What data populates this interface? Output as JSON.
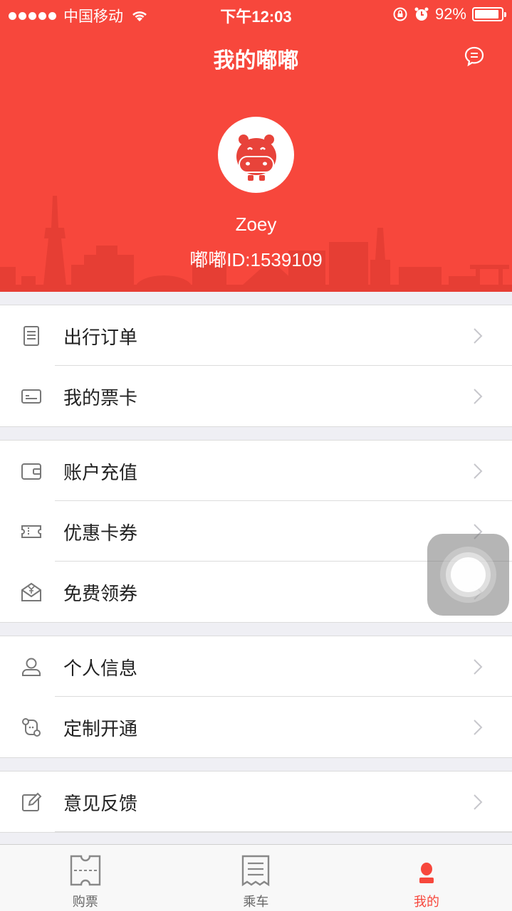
{
  "status": {
    "carrier": "中国移动",
    "time": "下午12:03",
    "battery_text": "92%",
    "battery_level": 0.92
  },
  "header": {
    "title": "我的嘟嘟",
    "username": "Zoey",
    "user_id": "嘟嘟ID:1539109"
  },
  "colors": {
    "brand": "#f7473c",
    "background": "#efeff4"
  },
  "menu": {
    "groups": [
      {
        "items": [
          {
            "label": "出行订单",
            "icon": "order-list-icon"
          },
          {
            "label": "我的票卡",
            "icon": "ticket-card-icon"
          }
        ]
      },
      {
        "items": [
          {
            "label": "账户充值",
            "icon": "wallet-icon"
          },
          {
            "label": "优惠卡券",
            "icon": "coupon-icon"
          },
          {
            "label": "免费领券",
            "icon": "yuan-envelope-icon"
          }
        ]
      },
      {
        "items": [
          {
            "label": "个人信息",
            "icon": "person-icon"
          },
          {
            "label": "定制开通",
            "icon": "route-icon"
          }
        ]
      },
      {
        "items": [
          {
            "label": "意见反馈",
            "icon": "edit-icon"
          }
        ]
      }
    ]
  },
  "tabbar": {
    "tabs": [
      {
        "label": "购票",
        "icon": "ticket-icon",
        "active": false
      },
      {
        "label": "乘车",
        "icon": "receipt-icon",
        "active": false
      },
      {
        "label": "我的",
        "icon": "profile-icon",
        "active": true
      }
    ]
  }
}
